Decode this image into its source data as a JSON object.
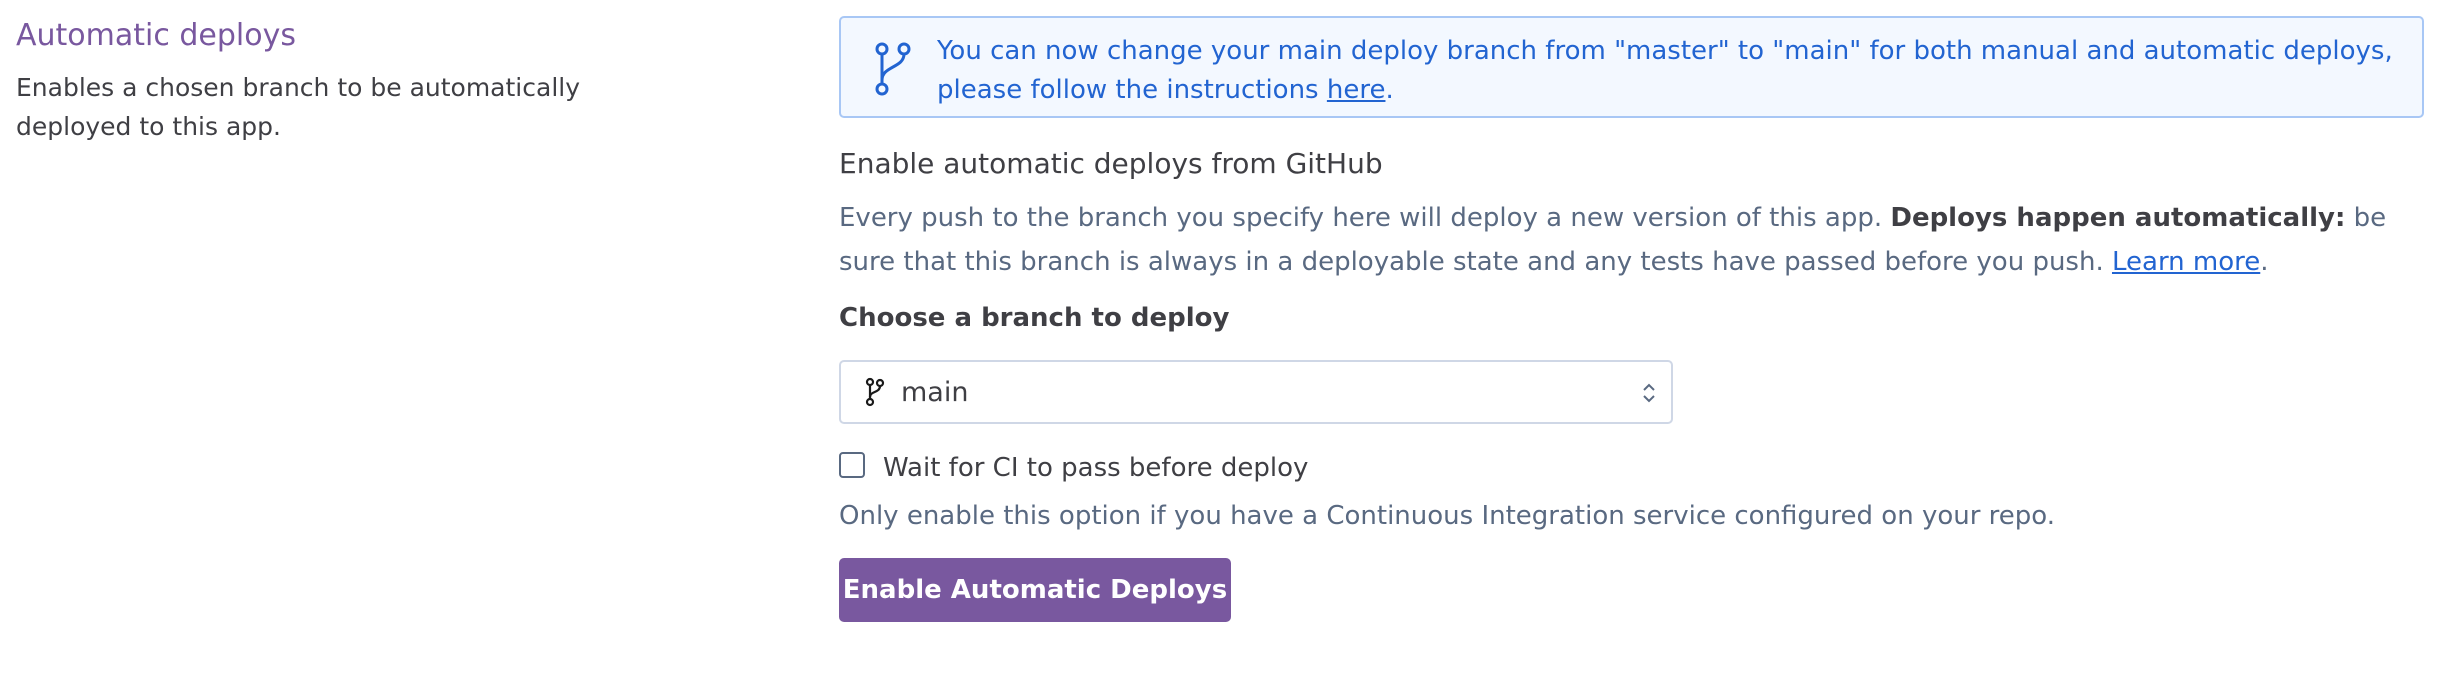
{
  "left": {
    "title": "Automatic deploys",
    "description": "Enables a chosen branch to be automatically deployed to this app."
  },
  "notice": {
    "icon": "git-branch-icon",
    "text_before": "You can now change your main deploy branch from \"master\" to \"main\" for both manual and automatic deploys, please follow the instructions ",
    "link": "here",
    "text_after": "."
  },
  "github": {
    "heading": "Enable automatic deploys from GitHub",
    "para_start": "Every push to the branch you specify here will deploy a new version of this app. ",
    "para_bold": "Deploys happen automatically:",
    "para_rest": " be sure that this branch is always in a deployable state and any tests have passed before you push. ",
    "learn_more": "Learn more",
    "para_end": "."
  },
  "branch_select": {
    "label": "Choose a branch to deploy",
    "value": "main",
    "icon": "git-branch-icon"
  },
  "ci": {
    "checkbox_label": "Wait for CI to pass before deploy",
    "checked": false,
    "help": "Only enable this option if you have a Continuous Integration service configured on your repo."
  },
  "button": {
    "label": "Enable Automatic Deploys"
  },
  "colors": {
    "accent": "#79589f",
    "link": "#2264d1",
    "notice_bg": "#f3f8ff",
    "notice_border": "#a8c7f5"
  }
}
